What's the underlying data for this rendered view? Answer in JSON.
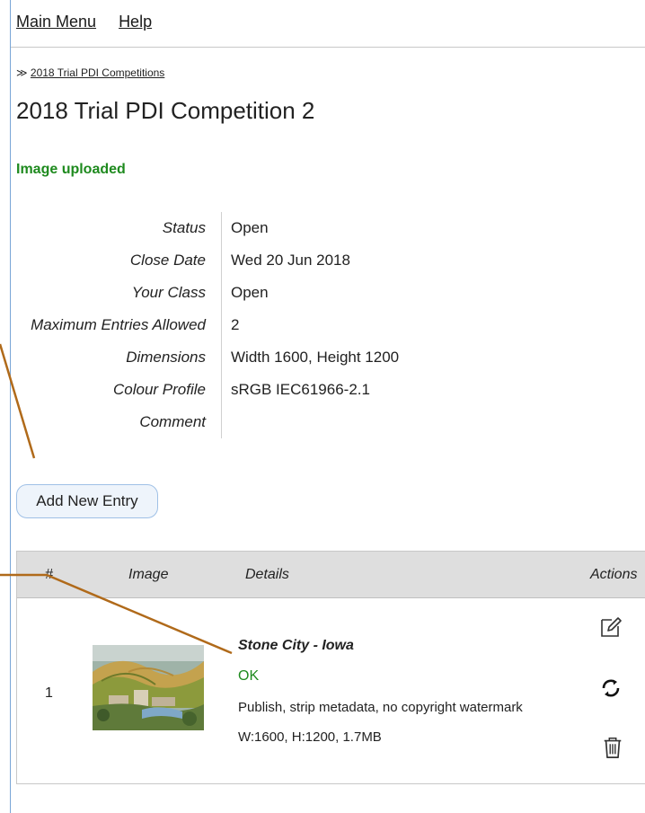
{
  "nav": {
    "main_menu": "Main Menu",
    "help": "Help"
  },
  "breadcrumb": {
    "prefix": "≫",
    "link": "2018 Trial PDI Competitions"
  },
  "page_title": "2018 Trial PDI Competition 2",
  "flash": "Image uploaded",
  "info": [
    {
      "label": "Status",
      "value": "Open"
    },
    {
      "label": "Close Date",
      "value": "Wed 20 Jun 2018"
    },
    {
      "label": "Your Class",
      "value": "Open"
    },
    {
      "label": "Maximum Entries Allowed",
      "value": "2"
    },
    {
      "label": "Dimensions",
      "value": "Width 1600, Height 1200"
    },
    {
      "label": "Colour Profile",
      "value": "sRGB IEC61966-2.1"
    },
    {
      "label": "Comment",
      "value": ""
    }
  ],
  "add_button": "Add New Entry",
  "entries": {
    "headers": {
      "num": "#",
      "image": "Image",
      "details": "Details",
      "actions": "Actions"
    },
    "rows": [
      {
        "num": "1",
        "title": "Stone City - Iowa",
        "status": "OK",
        "options": "Publish, strip metadata, no copyright watermark",
        "size": "W:1600, H:1200, 1.7MB"
      }
    ]
  },
  "icons": {
    "edit": "edit-icon",
    "replace": "refresh-icon",
    "delete": "trash-icon"
  },
  "colors": {
    "success": "#1e8a1e",
    "callout": "#b06a1a",
    "button_border": "#9fc0e6",
    "header_bg": "#dedede"
  }
}
